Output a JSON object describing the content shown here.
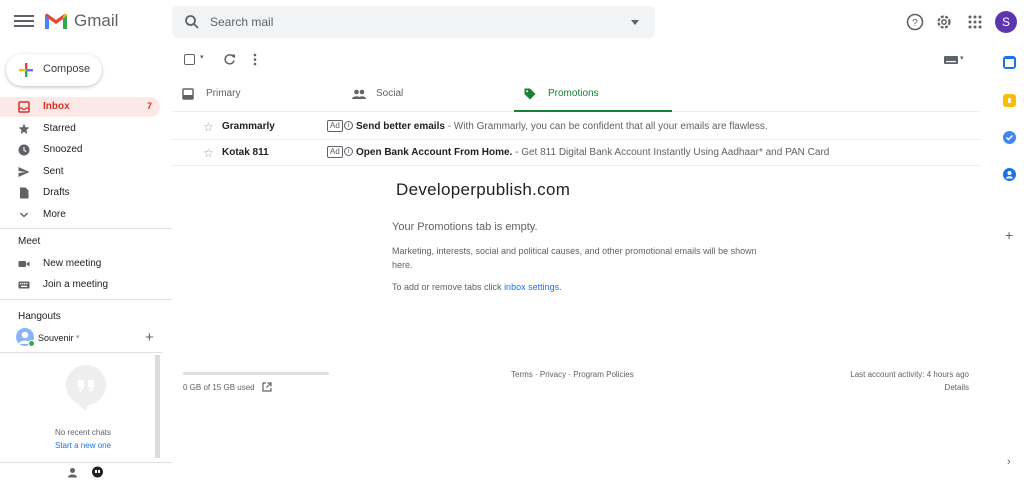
{
  "header": {
    "app_name": "Gmail",
    "search_placeholder": "Search mail",
    "avatar_initial": "S"
  },
  "sidebar": {
    "compose_label": "Compose",
    "items": [
      {
        "label": "Inbox",
        "count": "7",
        "icon": "inbox-icon",
        "active": true
      },
      {
        "label": "Starred",
        "icon": "star-icon"
      },
      {
        "label": "Snoozed",
        "icon": "clock-icon"
      },
      {
        "label": "Sent",
        "icon": "send-icon"
      },
      {
        "label": "Drafts",
        "icon": "draft-icon"
      },
      {
        "label": "More",
        "icon": "chevron-down-icon"
      }
    ],
    "meet": {
      "title": "Meet",
      "items": [
        {
          "label": "New meeting",
          "icon": "video-icon"
        },
        {
          "label": "Join a meeting",
          "icon": "keyboard-icon"
        }
      ]
    },
    "hangouts": {
      "title": "Hangouts",
      "user": "Souvenir",
      "no_chats": "No recent chats",
      "start_chat": "Start a new one"
    }
  },
  "tabs": [
    {
      "label": "Primary",
      "icon": "inbox-icon"
    },
    {
      "label": "Social",
      "icon": "people-icon"
    },
    {
      "label": "Promotions",
      "icon": "tag-icon",
      "active": true
    }
  ],
  "emails": [
    {
      "sender": "Grammarly",
      "badge": "Ad",
      "subject": "Send better emails",
      "snippet": " - With Grammarly, you can be confident that all your emails are flawless."
    },
    {
      "sender": "Kotak 811",
      "badge": "Ad",
      "subject": "Open Bank Account From Home.",
      "snippet": " - Get 811 Digital Bank Account Instantly Using Aadhaar* and PAN Card"
    }
  ],
  "watermark": "Developerpublish.com",
  "empty": {
    "title": "Your Promotions tab is empty.",
    "description": "Marketing, interests, social and political causes, and other promotional emails will be shown here.",
    "tabs_prefix": "To add or remove tabs click ",
    "tabs_link": "inbox settings",
    "tabs_suffix": "."
  },
  "footer": {
    "storage": "0 GB of 15 GB used",
    "storage_fraction": 0.0,
    "links": "Terms · Privacy · Program Policies",
    "activity": "Last account activity: 4 hours ago",
    "details": "Details"
  },
  "colors": {
    "accent_red": "#d93025",
    "promotions_green": "#188038",
    "link_blue": "#1a73e8",
    "avatar_purple": "#5e35b1"
  }
}
